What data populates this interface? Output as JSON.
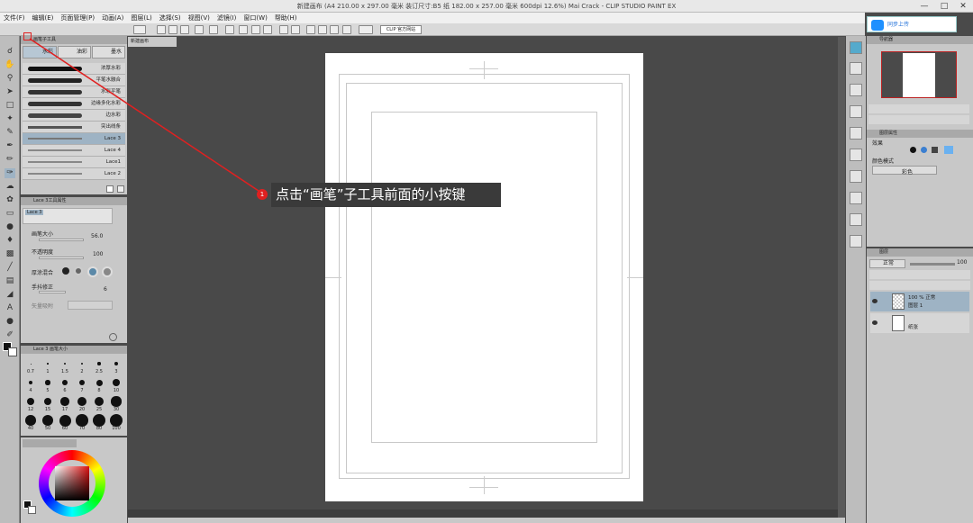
{
  "window": {
    "title": "新建画布 (A4 210.00 x 297.00 毫米 装订尺寸:B5 纸 182.00 x 257.00 毫米 600dpi 12.6%) Mai Crack - CLIP STUDIO PAINT EX",
    "buttons": [
      "—",
      "□",
      "✕"
    ]
  },
  "menu": [
    "文件(F)",
    "编辑(E)",
    "页面管理(P)",
    "动画(A)",
    "图层(L)",
    "选择(S)",
    "视图(V)",
    "滤镜(I)",
    "窗口(W)",
    "帮助(H)"
  ],
  "command_bar": {
    "clip_button": "CLIP 官方网站"
  },
  "upload_button": "同步上传",
  "subtool_panel": {
    "title": "画笔子工具",
    "tabs": [
      "水彩",
      "油彩",
      "墨水"
    ],
    "brushes": [
      "浓厚水彩",
      "平笔水融合",
      "水彩平笔",
      "边缘多化水彩",
      "边水彩",
      "突出线条",
      "Lace 3",
      "Lace 4",
      "Lace1",
      "Lace 2"
    ],
    "selected": "Lace 3"
  },
  "tool_property": {
    "title": "Lace 3工具属性",
    "preset_name": "Lace 3",
    "brush_size_label": "画笔大小",
    "brush_size_value": "56.0",
    "opacity_label": "不透明度",
    "opacity_value": "100",
    "blend_label": "厚涂混合",
    "stabilize_label": "手抖修正",
    "stabilize_value": "6",
    "vector_label": "矢量吸附"
  },
  "brush_size_panel": {
    "title": "Lace 3 画笔大小",
    "sizes": [
      "0.7",
      "1",
      "1.5",
      "2",
      "2.5",
      "3",
      "4",
      "5",
      "6",
      "7",
      "8",
      "10",
      "12",
      "15",
      "17",
      "20",
      "25",
      "30",
      "40",
      "50",
      "60",
      "70",
      "80",
      "100"
    ]
  },
  "document_tab": "新建画布",
  "navigator": {
    "title": "导航器"
  },
  "layer_property": {
    "title": "图层属性",
    "effect_label": "效果",
    "color_mode_label": "颜色模式",
    "color_mode_value": "彩色"
  },
  "layer_panel": {
    "title": "图层",
    "blend_mode": "正常",
    "opacity": "100",
    "layers": [
      {
        "opacity_mode": "100 % 正常",
        "name": "图层 1"
      },
      {
        "opacity_mode": "",
        "name": "纸张"
      }
    ]
  },
  "annotation": {
    "step": "1",
    "text": "点击“画笔”子工具前面的小按键"
  },
  "colors": {
    "accent": "#e02020",
    "canvas_bg": "#494949",
    "panel": "#c8c8c8"
  }
}
